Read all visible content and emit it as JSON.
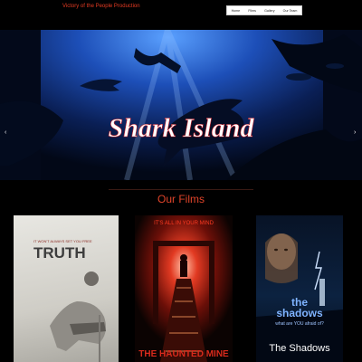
{
  "header": {
    "brand": "Victory of the People Production",
    "nav": [
      "Home",
      "Films",
      "Gallery",
      "Our Team"
    ]
  },
  "hero": {
    "title": "Shark Island",
    "prev_icon": "chevron-left-icon",
    "next_icon": "chevron-right-icon"
  },
  "section": {
    "title": "Our Films"
  },
  "films": [
    {
      "tagline": "IT WON'T ALWAYS SET YOU FREE",
      "title": "TRUTH"
    },
    {
      "tagline": "IT'S ALL IN YOUR MIND",
      "title": "THE HAUNTED MINE"
    },
    {
      "title_line1": "the",
      "title_line2": "shadows",
      "tagline": "what are YOU afraid of?",
      "caption": "The Shadows"
    }
  ],
  "colors": {
    "accent": "#e0442a",
    "background": "#000000"
  }
}
